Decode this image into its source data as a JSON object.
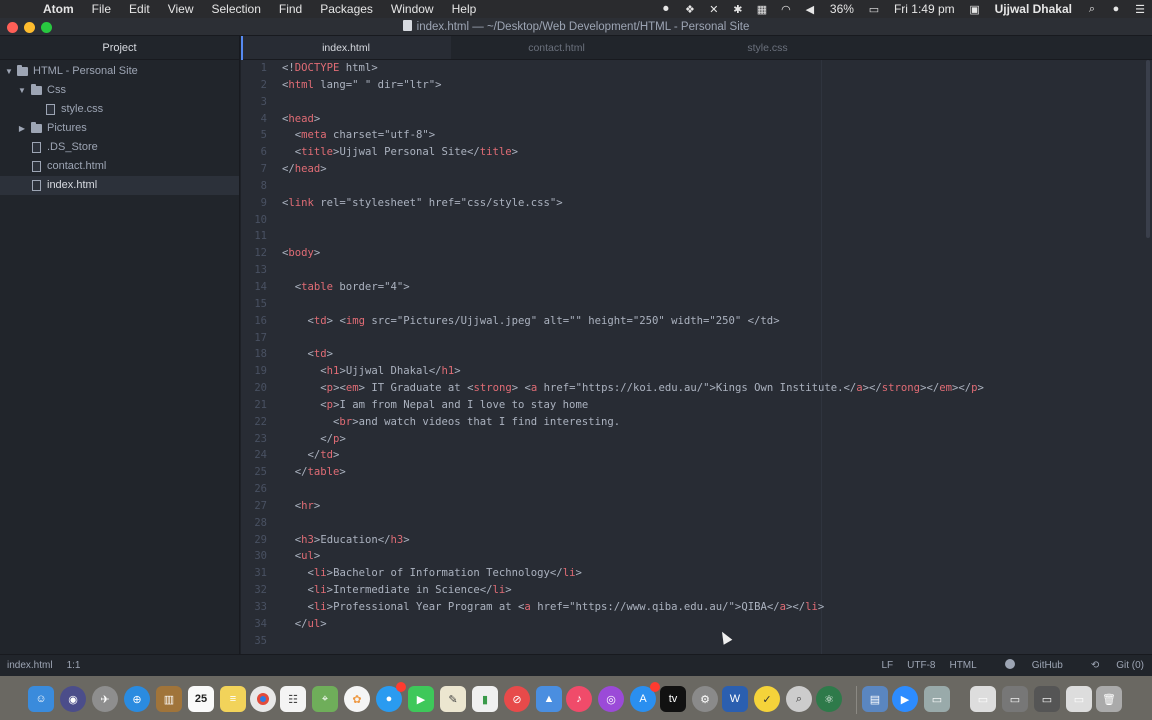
{
  "menubar": {
    "app": "Atom",
    "items": [
      "File",
      "Edit",
      "View",
      "Selection",
      "Find",
      "Packages",
      "Window",
      "Help"
    ],
    "battery": "36%",
    "clock": "Fri 1:49 pm",
    "user": "Ujjwal Dhakal"
  },
  "window": {
    "title": "index.html — ~/Desktop/Web Development/HTML - Personal Site"
  },
  "sidebar": {
    "title": "Project",
    "root": "HTML - Personal Site",
    "items": [
      {
        "label": "Css",
        "type": "folder",
        "expanded": true
      },
      {
        "label": "style.css",
        "type": "file"
      },
      {
        "label": "Pictures",
        "type": "folder",
        "expanded": false
      },
      {
        "label": ".DS_Store",
        "type": "file"
      },
      {
        "label": "contact.html",
        "type": "file"
      },
      {
        "label": "index.html",
        "type": "file",
        "selected": true
      }
    ]
  },
  "tabs": [
    {
      "label": "index.html",
      "active": true
    },
    {
      "label": "contact.html",
      "active": false
    },
    {
      "label": "style.css",
      "active": false
    }
  ],
  "editor": {
    "line_numbers": [
      "1",
      "2",
      "3",
      "4",
      "5",
      "6",
      "7",
      "8",
      "9",
      "10",
      "11",
      "12",
      "13",
      "14",
      "15",
      "16",
      "17",
      "18",
      "19",
      "20",
      "21",
      "22",
      "23",
      "24",
      "25",
      "26",
      "27",
      "28",
      "29",
      "30",
      "31",
      "32",
      "33",
      "34",
      "35"
    ],
    "lines": [
      "<!DOCTYPE html>",
      "<html lang=\" \" dir=\"ltr\">",
      "",
      "<head>",
      "  <meta charset=\"utf-8\">",
      "  <title>Ujjwal Personal Site</title>",
      "</head>",
      "",
      "<link rel=\"stylesheet\" href=\"css/style.css\">",
      "",
      "",
      "<body>",
      "",
      "  <table border=\"4\">",
      "",
      "    <td> <img src=\"Pictures/Ujjwal.jpeg\" alt=\"\" height=\"250\" width=\"250\" </td>",
      "",
      "    <td>",
      "      <h1>Ujjwal Dhakal</h1>",
      "      <p><em> IT Graduate at <strong> <a href=\"https://koi.edu.au/\">Kings Own Institute.</a></strong></em></p>",
      "      <p>I am from Nepal and I love to stay home",
      "        <br>and watch videos that I find interesting.",
      "      </p>",
      "    </td>",
      "  </table>",
      "",
      "  <hr>",
      "",
      "  <h3>Education</h3>",
      "  <ul>",
      "    <li>Bachelor of Information Technology</li>",
      "    <li>Intermediate in Science</li>",
      "    <li>Professional Year Program at <a href=\"https://www.qiba.edu.au/\">QIBA</a></li>",
      "  </ul>",
      ""
    ]
  },
  "statusbar": {
    "file": "index.html",
    "cursor": "1:1",
    "line_ending": "LF",
    "encoding": "UTF-8",
    "grammar": "HTML",
    "github": "GitHub",
    "git": "Git (0)"
  },
  "dock": {
    "calendar_day": "25"
  },
  "colors": {
    "accent": "#568af2",
    "editor_bg": "#282c34",
    "sidebar_bg": "#21252b"
  }
}
